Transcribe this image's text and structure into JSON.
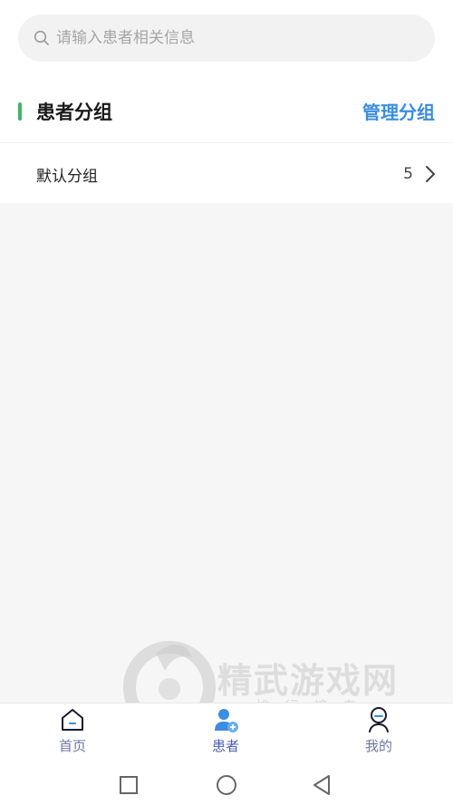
{
  "search": {
    "placeholder": "请输入患者相关信息",
    "value": ""
  },
  "section": {
    "title": "患者分组",
    "manage_label": "管理分组"
  },
  "groups": [
    {
      "name": "默认分组",
      "count": "5"
    }
  ],
  "tabs": [
    {
      "label": "首页",
      "icon": "home-icon"
    },
    {
      "label": "患者",
      "icon": "patient-icon",
      "active": true
    },
    {
      "label": "我的",
      "icon": "profile-icon"
    }
  ],
  "watermark": {
    "title": "精武游戏网",
    "subtitle": "排行榜专"
  },
  "colors": {
    "accent_green": "#3fb56a",
    "link_blue": "#3a8de0",
    "tab_text": "#6f76a8"
  }
}
